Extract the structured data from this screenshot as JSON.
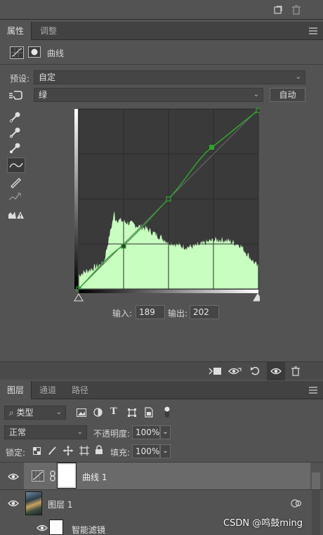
{
  "top_bar": {
    "new_icon": "new-layer-icon",
    "trash_icon": "trash-icon"
  },
  "properties_panel": {
    "tabs": [
      {
        "label": "属性",
        "active": true
      },
      {
        "label": "调整",
        "active": false
      }
    ],
    "title": "曲线",
    "preset_label": "预设:",
    "preset_value": "自定",
    "channel_value": "绿",
    "auto_button": "自动",
    "input_label": "输入:",
    "input_value": "189",
    "output_label": "输出:",
    "output_value": "202",
    "curve_color": "#2fa32f",
    "histogram_color": "#c8ffc0"
  },
  "layers_panel": {
    "tabs": [
      {
        "label": "图层",
        "active": true
      },
      {
        "label": "通道",
        "active": false
      },
      {
        "label": "路径",
        "active": false
      }
    ],
    "filter_label": "类型",
    "blend_mode": "正常",
    "opacity_label": "不透明度:",
    "opacity_value": "100%",
    "lock_label": "锁定:",
    "fill_label": "填充:",
    "fill_value": "100%",
    "layers": [
      {
        "name": "曲线 1",
        "selected": true
      },
      {
        "name": "图层 1",
        "selected": false
      },
      {
        "name": "智能滤镜",
        "selected": false
      }
    ]
  },
  "watermark": "CSDN @鸣鼓ming"
}
